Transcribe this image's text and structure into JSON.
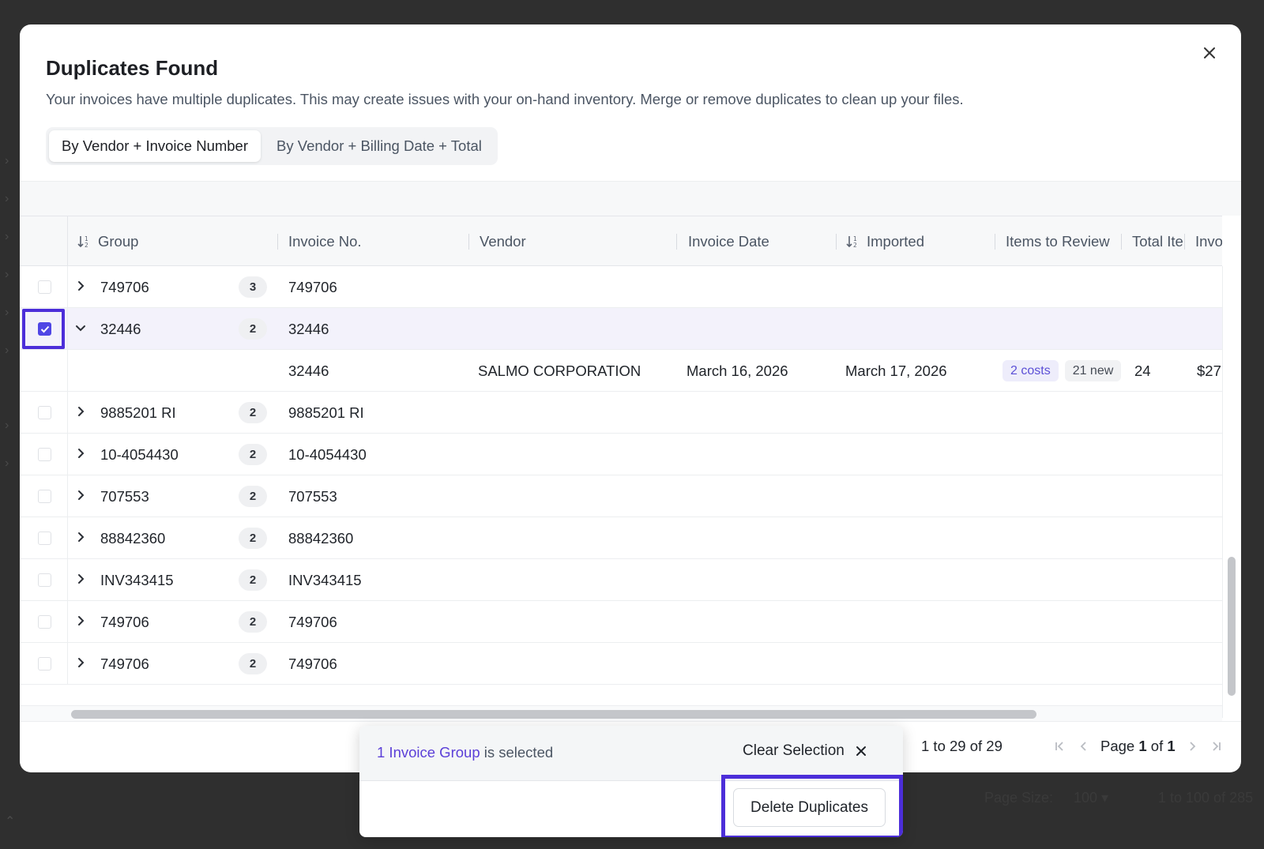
{
  "modal": {
    "title": "Duplicates Found",
    "description": "Your invoices have multiple duplicates. This may create issues with your on-hand inventory. Merge or remove duplicates to clean up your files.",
    "tabs": [
      {
        "label": "By Vendor + Invoice Number",
        "active": true
      },
      {
        "label": "By Vendor + Billing Date + Total",
        "active": false
      }
    ]
  },
  "grid": {
    "columns": [
      "Group",
      "Invoice No.",
      "Vendor",
      "Invoice Date",
      "Imported",
      "Items to Review",
      "Total Ite",
      "Invoic"
    ],
    "rows": [
      {
        "group": "749706",
        "count": "3",
        "invoice_no": "749706"
      },
      {
        "group": "32446",
        "count": "2",
        "invoice_no": "32446",
        "selected": true,
        "expanded": true
      },
      {
        "child": true,
        "invoice_no": "32446",
        "vendor": "SALMO CORPORATION",
        "invoice_date": "March 16, 2026",
        "imported": "March 17, 2026",
        "review_costs": "2 costs",
        "review_new": "21 new",
        "total_items": "24",
        "invoice_total": "$27"
      },
      {
        "group": "9885201 RI",
        "count": "2",
        "invoice_no": "9885201 RI"
      },
      {
        "group": "10-4054430",
        "count": "2",
        "invoice_no": "10-4054430"
      },
      {
        "group": "707553",
        "count": "2",
        "invoice_no": "707553"
      },
      {
        "group": "88842360",
        "count": "2",
        "invoice_no": "88842360"
      },
      {
        "group": "INV343415",
        "count": "2",
        "invoice_no": "INV343415"
      },
      {
        "group": "749706",
        "count": "2",
        "invoice_no": "749706"
      },
      {
        "group": "749706",
        "count": "2",
        "invoice_no": "749706"
      }
    ]
  },
  "pager": {
    "count": "1 to 29 of 29",
    "page_prefix": "Page",
    "page_current": "1",
    "page_of": "of",
    "page_total": "1"
  },
  "selection": {
    "count_link": "1 Invoice Group",
    "suffix": " is selected",
    "clear_label": "Clear Selection",
    "delete_label": "Delete Duplicates"
  },
  "background": {
    "footer_page_size_label": "Page Size:",
    "footer_page_size_value": "100",
    "footer_count": "1 to 100 of 285"
  },
  "colors": {
    "accent": "#4f46e5",
    "highlight_border": "#4c2ed9",
    "link": "#5b3fd8"
  }
}
